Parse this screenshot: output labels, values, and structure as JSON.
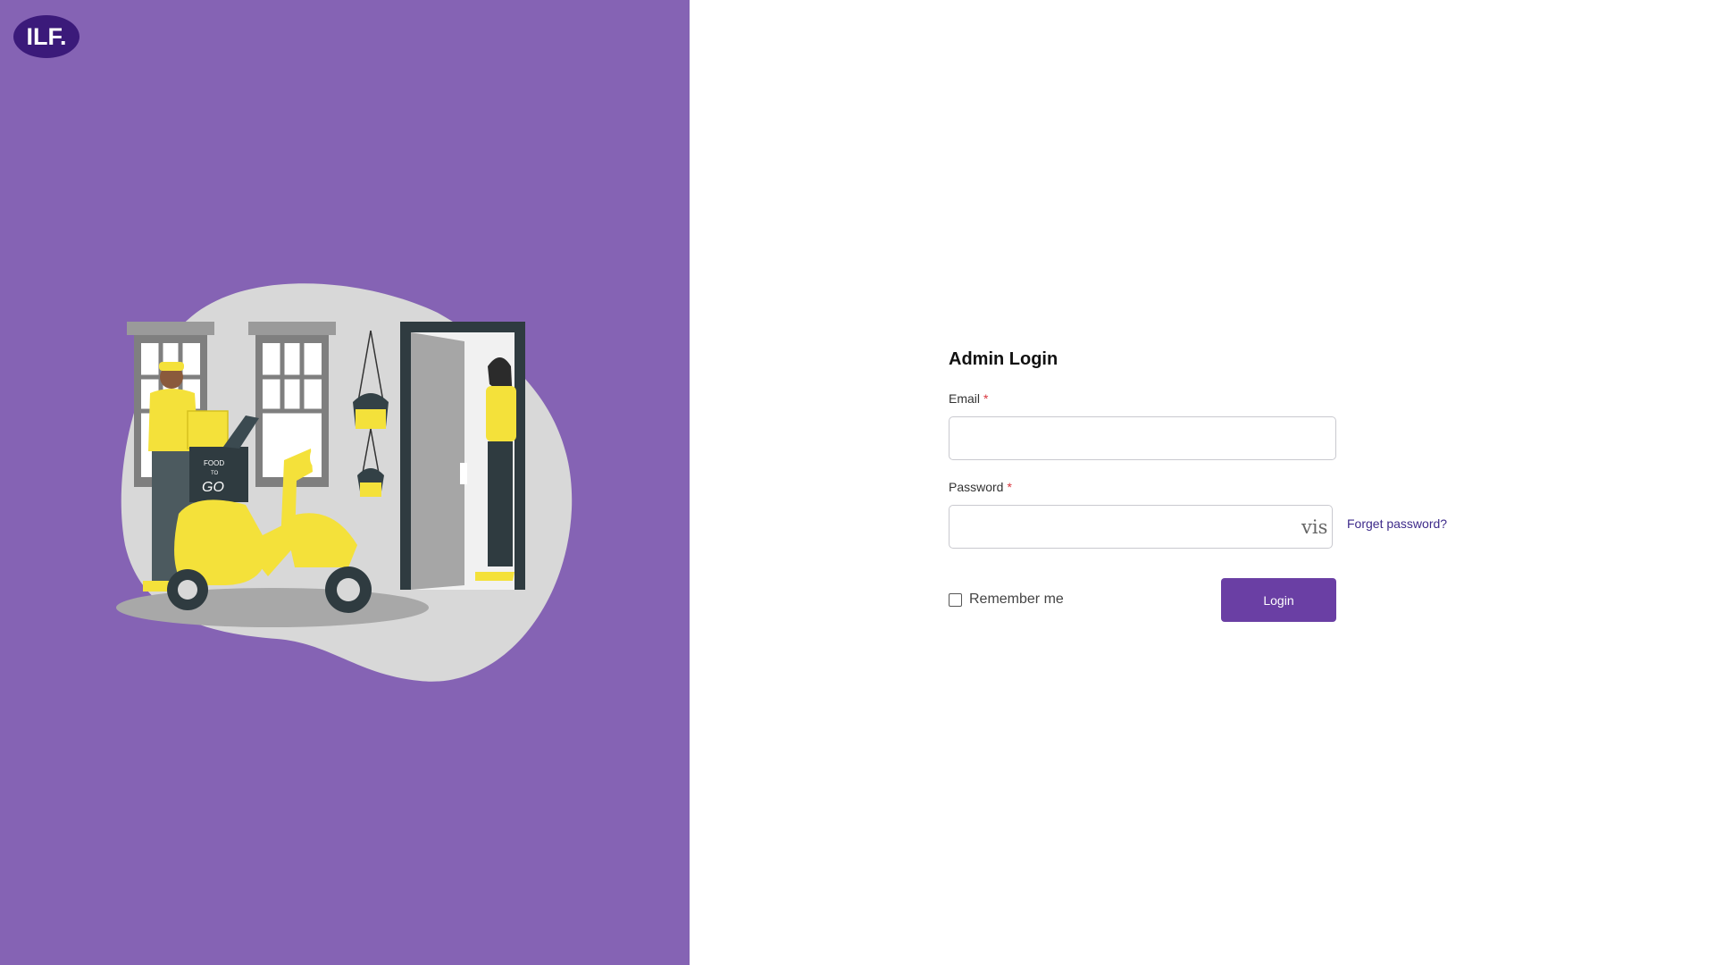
{
  "brand": {
    "logo_text": "ILF."
  },
  "illustration": {
    "box_line1": "FOOD",
    "box_line2": "TO",
    "box_line3": "GO"
  },
  "login": {
    "title": "Admin Login",
    "email_label": "Email",
    "required_mark": "*",
    "email_value": "",
    "password_label": "Password",
    "password_value": "",
    "visibility_toggle": "vis",
    "forgot_link": "Forget password?",
    "remember_label": "Remember me",
    "remember_checked": false,
    "login_button": "Login"
  },
  "colors": {
    "left_panel": "#8563b4",
    "logo_bg": "#3b1a7a",
    "button": "#6a3fa4",
    "link": "#3d2a8a",
    "required": "#d9363e"
  }
}
